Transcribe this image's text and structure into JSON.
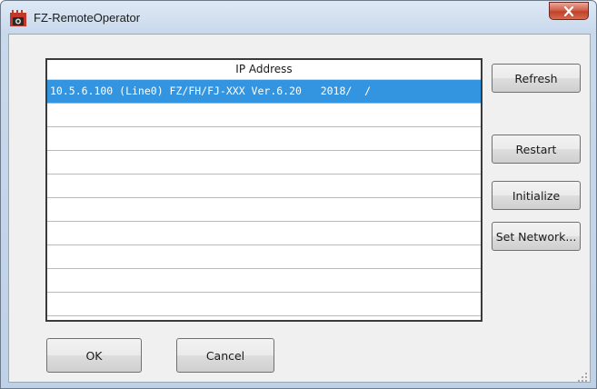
{
  "window": {
    "title": "FZ-RemoteOperator",
    "icon": "app-camera-icon",
    "close_glyph": "x"
  },
  "list": {
    "column_header": "IP Address",
    "rows": [
      {
        "text": "10.5.6.100 (Line0) FZ/FH/FJ-XXX Ver.6.20   2018/  /",
        "selected": true
      },
      {
        "text": "",
        "selected": false
      },
      {
        "text": "",
        "selected": false
      },
      {
        "text": "",
        "selected": false
      },
      {
        "text": "",
        "selected": false
      },
      {
        "text": "",
        "selected": false
      },
      {
        "text": "",
        "selected": false
      },
      {
        "text": "",
        "selected": false
      },
      {
        "text": "",
        "selected": false
      },
      {
        "text": "",
        "selected": false
      }
    ]
  },
  "buttons": {
    "refresh": "Refresh",
    "restart": "Restart",
    "initialize": "Initialize",
    "set_network": "Set Network...",
    "ok": "OK",
    "cancel": "Cancel"
  },
  "colors": {
    "selection": "#3394e0",
    "close_button": "#c9452e"
  }
}
